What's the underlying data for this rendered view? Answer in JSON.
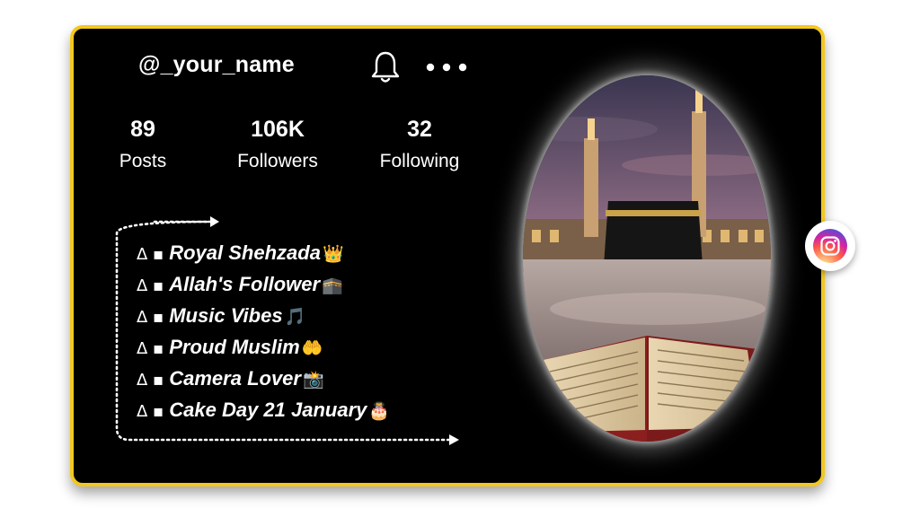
{
  "profile": {
    "username": "@_your_name",
    "stats": [
      {
        "value": "89",
        "label": "Posts"
      },
      {
        "value": "106K",
        "label": "Followers"
      },
      {
        "value": "32",
        "label": "Following"
      }
    ]
  },
  "bio": {
    "prefix": "Δ ▪",
    "lines": [
      {
        "text": "Royal Shehzada",
        "emoji": "👑"
      },
      {
        "text": "Allah's Follower",
        "emoji": "🕋"
      },
      {
        "text": "Music Vibes",
        "emoji": "🎵"
      },
      {
        "text": "Proud Muslim",
        "emoji": "🤲"
      },
      {
        "text": "Camera Lover",
        "emoji": "📸"
      },
      {
        "text": "Cake Day 21 January",
        "emoji": "🎂"
      }
    ]
  },
  "icons": {
    "notifications": "bell-icon",
    "more": "more-dots-icon",
    "social": "instagram-icon"
  },
  "colors": {
    "card_background": "#000000",
    "card_border": "#f2c81f",
    "text": "#ffffff"
  }
}
